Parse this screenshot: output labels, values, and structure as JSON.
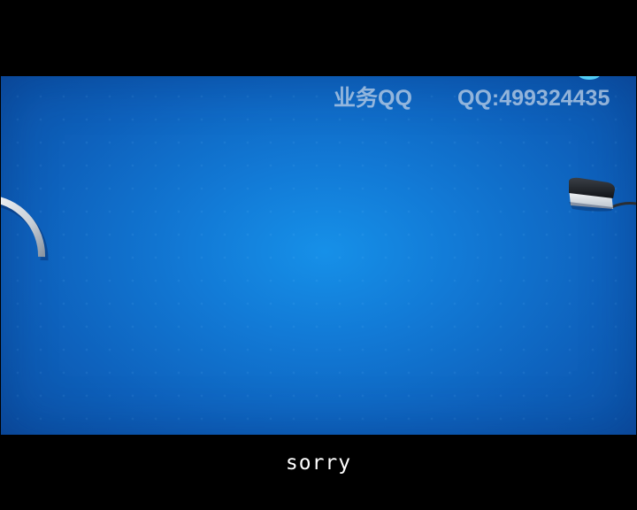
{
  "video": {
    "watermark_left": "业务QQ",
    "watermark_right": "QQ:499324435",
    "background_color": "#127ad6",
    "decorations": [
      "curved-bar-icon",
      "device-icon"
    ]
  },
  "subtitle": {
    "text": "sorry"
  }
}
